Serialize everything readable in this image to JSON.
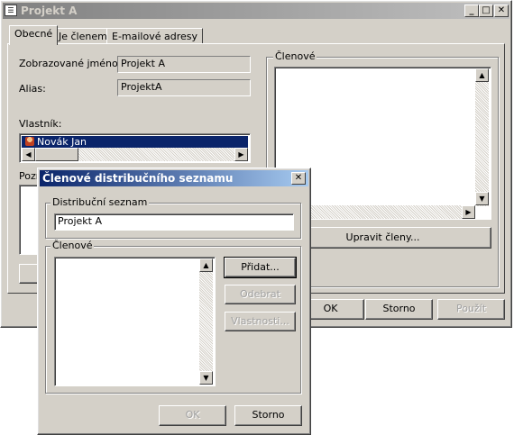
{
  "main": {
    "title": "Projekt A",
    "tabs": [
      "Obecné",
      "Je členem",
      "E-mailové adresy"
    ],
    "display_name_label": "Zobrazované jméno:",
    "display_name_value": "Projekt A",
    "alias_label": "Alias:",
    "alias_value": "ProjektA",
    "owner_label": "Vlastník:",
    "owner_value": "Novák Jan",
    "notes_label_partial": "Pozn",
    "members_group": "Členové",
    "edit_members_button": "Upravit členy...",
    "ok": "OK",
    "cancel": "Storno",
    "apply": "Použít"
  },
  "dialog": {
    "title": "Členové distribučního seznamu",
    "list_group": "Distribuční seznam",
    "list_value": "Projekt A",
    "members_group": "Členové",
    "add": "Přidat...",
    "remove": "Odebrat",
    "properties": "Vlastnosti...",
    "ok": "OK",
    "cancel": "Storno"
  }
}
